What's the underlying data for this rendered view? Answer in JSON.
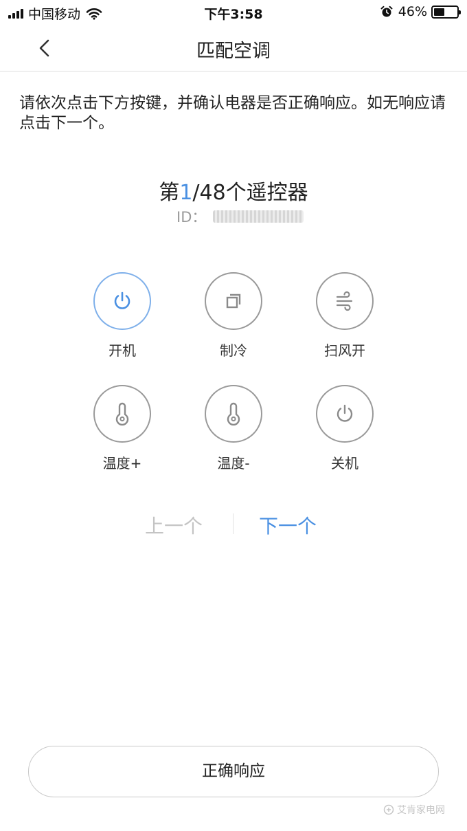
{
  "status_bar": {
    "carrier": "中国移动",
    "time": "下午3:58",
    "battery_text": "46%",
    "battery_level": 0.46
  },
  "nav": {
    "title": "匹配空调",
    "back_icon": "chevron-left-icon"
  },
  "instruction": "请依次点击下方按键，并确认电器是否正确响应。如无响应请点击下一个。",
  "remote": {
    "prefix": "第",
    "current": "1",
    "suffix": "/48个遥控器",
    "id_label": "ID："
  },
  "keys": [
    {
      "label": "开机",
      "icon": "power-icon",
      "active": true
    },
    {
      "label": "制冷",
      "icon": "copy-squares-icon",
      "active": false
    },
    {
      "label": "扫风开",
      "icon": "wind-icon",
      "active": false
    },
    {
      "label": "温度+",
      "icon": "thermometer-icon",
      "active": false
    },
    {
      "label": "温度-",
      "icon": "thermometer-icon",
      "active": false
    },
    {
      "label": "关机",
      "icon": "power-icon",
      "active": false
    }
  ],
  "pager": {
    "prev": "上一个",
    "next": "下一个"
  },
  "confirm_button": "正确响应",
  "watermark": "艾肯家电网",
  "colors": {
    "accent": "#4a90e2",
    "active_ring": "#7fb0ea",
    "icon_gray": "#9a9a9a",
    "disabled": "#c4c4c4"
  }
}
